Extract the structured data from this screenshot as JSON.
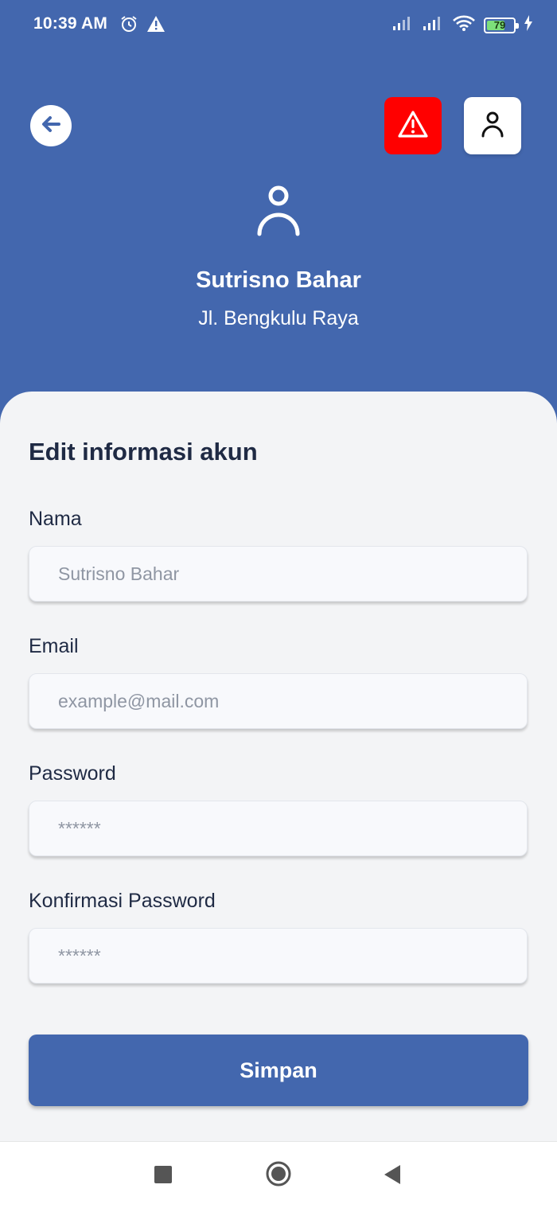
{
  "status_bar": {
    "time": "10:39 AM",
    "battery": "79",
    "icons": [
      "alarm-icon",
      "warning-icon",
      "signal-icon",
      "signal-icon",
      "wifi-icon",
      "battery-icon",
      "charging-icon"
    ]
  },
  "header": {
    "back_icon": "arrow-left-icon",
    "alert_icon": "warning-icon",
    "profile_icon": "person-icon",
    "avatar_icon": "person-icon",
    "user_name": "Sutrisno Bahar",
    "user_address": "Jl. Bengkulu Raya"
  },
  "form": {
    "title": "Edit informasi akun",
    "fields": [
      {
        "label": "Nama",
        "placeholder": "Sutrisno Bahar",
        "value": ""
      },
      {
        "label": "Email",
        "placeholder": "example@mail.com",
        "value": ""
      },
      {
        "label": "Password",
        "placeholder": "******",
        "value": ""
      },
      {
        "label": "Konfirmasi Password",
        "placeholder": "******",
        "value": ""
      }
    ],
    "submit_label": "Simpan"
  },
  "colors": {
    "primary": "#4367ae",
    "alert": "#ff0000",
    "background": "#f3f4f6",
    "text": "#1f2a44"
  },
  "nav_bar": {
    "icons": [
      "recent-apps-icon",
      "home-icon",
      "back-icon"
    ]
  }
}
